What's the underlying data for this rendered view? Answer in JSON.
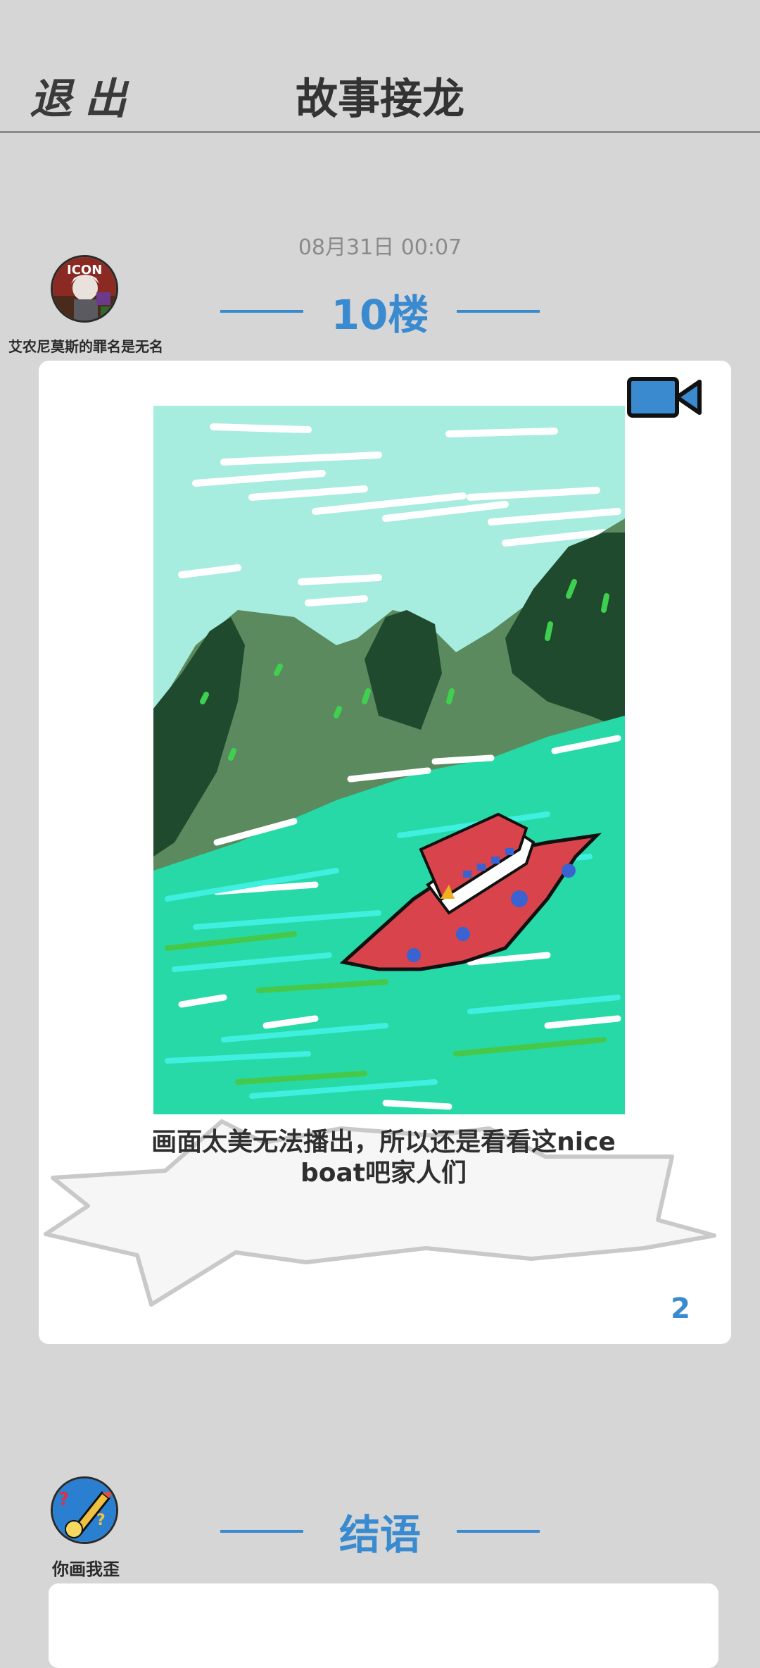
{
  "header": {
    "exit_label": "退出",
    "title": "故事接龙"
  },
  "post": {
    "timestamp": "08月31日  00:07",
    "floor": "10楼",
    "author": "艾农尼莫斯的罪名是无名",
    "caption": "画面太美无法播出，所以还是看看这nice boat吧家人们",
    "count": "2",
    "icons": {
      "video": "video-camera-icon"
    }
  },
  "ending": {
    "label": "结语",
    "author": "你画我歪"
  },
  "colors": {
    "accent": "#3a8ad0",
    "background": "#d6d6d6",
    "title": "#333333"
  }
}
